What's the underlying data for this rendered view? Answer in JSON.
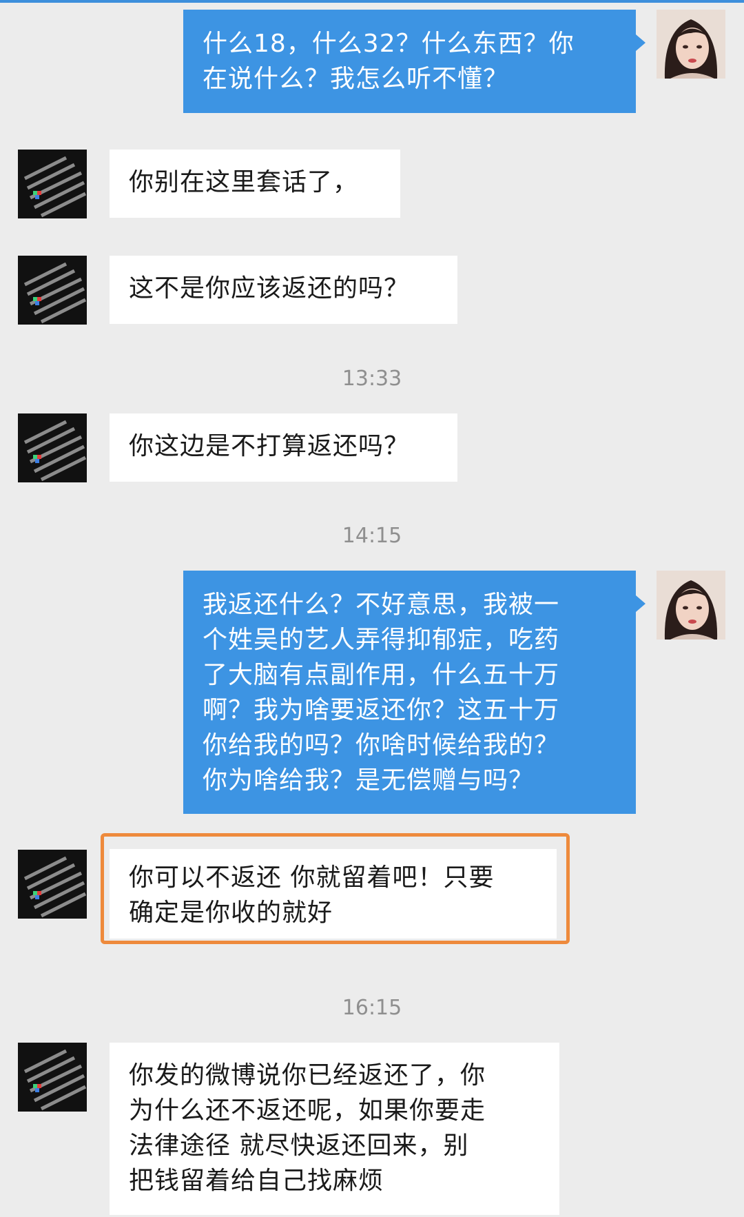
{
  "messages": [
    {
      "side": "out",
      "lines": [
        "什么18，什么32？什么东西？你",
        "在说什么？我怎么听不懂？"
      ]
    },
    {
      "side": "in",
      "lines": [
        "你别在这里套话了，"
      ]
    },
    {
      "side": "in",
      "lines": [
        "这不是你应该返还的吗？"
      ]
    },
    {
      "side": "in",
      "lines": [
        "你这边是不打算返还吗？"
      ]
    },
    {
      "side": "out",
      "lines": [
        "我返还什么？不好意思，我被一",
        "个姓吴的艺人弄得抑郁症，吃药",
        "了大脑有点副作用，什么五十万",
        "啊？我为啥要返还你？这五十万",
        "你给我的吗？你啥时候给我的？",
        "你为啥给我？是无偿赠与吗？"
      ]
    },
    {
      "side": "in",
      "lines": [
        "你可以不返还  你就留着吧！只要",
        "确定是你收的就好"
      ]
    },
    {
      "side": "in",
      "lines": [
        "你发的微博说你已经返还了，你",
        "为什么还不返还呢，如果你要走",
        "法律途径  就尽快返还回来，别",
        "把钱留着给自己找麻烦"
      ]
    }
  ],
  "timestamps": [
    "13:33",
    "14:15",
    "16:15"
  ],
  "colors": {
    "outgoing_bubble": "#3d94e3",
    "incoming_bubble": "#ffffff",
    "background": "#ececec",
    "highlight_box": "#ee8a3c"
  }
}
